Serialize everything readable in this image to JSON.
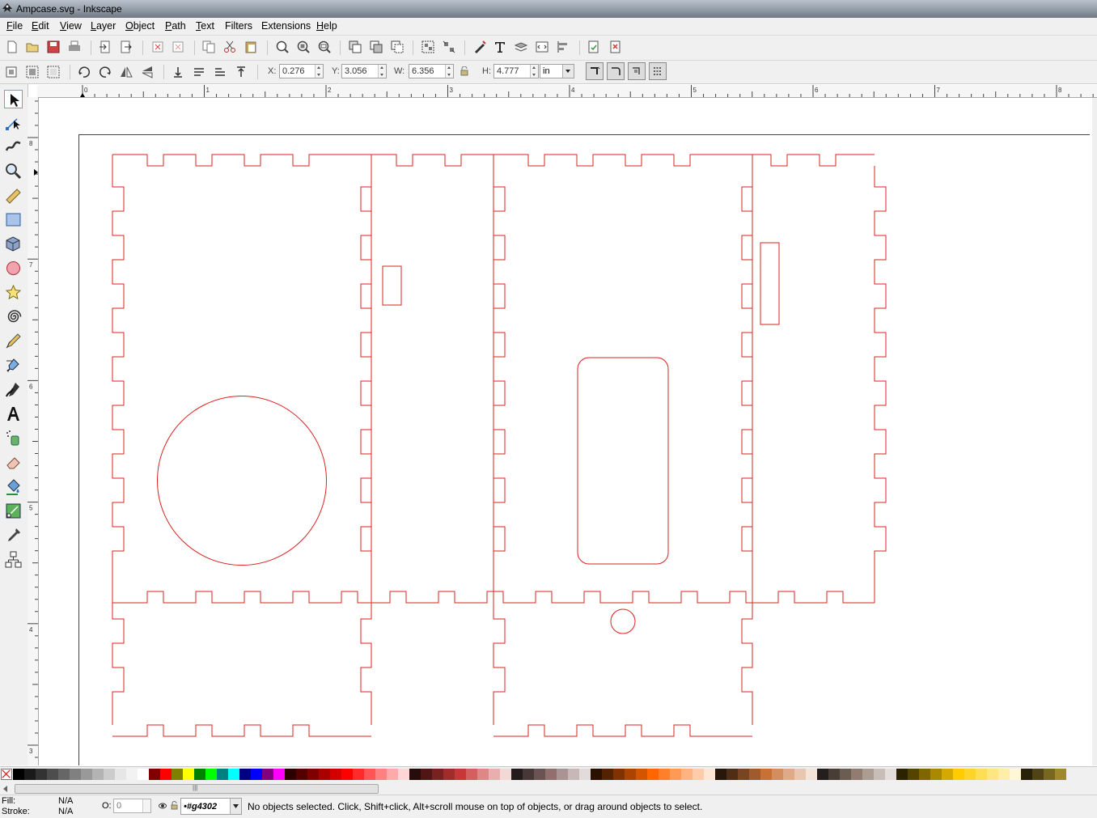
{
  "window": {
    "title": "Ampcase.svg - Inkscape"
  },
  "menus": [
    {
      "label": "File",
      "key": "F",
      "rest": "ile"
    },
    {
      "label": "Edit",
      "key": "E",
      "rest": "dit"
    },
    {
      "label": "View",
      "key": "V",
      "rest": "iew"
    },
    {
      "label": "Layer",
      "key": "L",
      "rest": "ayer"
    },
    {
      "label": "Object",
      "key": "O",
      "rest": "bject"
    },
    {
      "label": "Path",
      "key": "P",
      "rest": "ath"
    },
    {
      "label": "Text",
      "key": "T",
      "rest": "ext"
    },
    {
      "label": "Filters",
      "key": "",
      "rest": "Filters"
    },
    {
      "label": "Extensions",
      "key": "",
      "rest": "Extensions"
    },
    {
      "label": "Help",
      "key": "H",
      "rest": "elp"
    }
  ],
  "selector": {
    "x_label": "X:",
    "x_value": "0.276",
    "y_label": "Y:",
    "y_value": "3.056",
    "w_label": "W:",
    "w_value": "6.356",
    "h_label": "H:",
    "h_value": "4.777",
    "unit": "in"
  },
  "rulers": {
    "horizontal": [
      "0",
      "1",
      "2",
      "3",
      "4",
      "5",
      "6",
      "7",
      "8"
    ],
    "vertical": [
      "8",
      "7",
      "6",
      "5",
      "4",
      "3"
    ]
  },
  "palette": {
    "colors": [
      "#000000",
      "#1a1a1a",
      "#333333",
      "#4d4d4d",
      "#666666",
      "#808080",
      "#999999",
      "#b3b3b3",
      "#cccccc",
      "#e6e6e6",
      "#f2f2f2",
      "#ffffff",
      "#800000",
      "#ff0000",
      "#808000",
      "#ffff00",
      "#008000",
      "#00ff00",
      "#008080",
      "#00ffff",
      "#000080",
      "#0000ff",
      "#800080",
      "#ff00ff",
      "#2b0000",
      "#550000",
      "#800000",
      "#aa0000",
      "#d40000",
      "#ff0000",
      "#ff2a2a",
      "#ff5555",
      "#ff8080",
      "#ffaaaa",
      "#ffd5d5",
      "#280b0b",
      "#501616",
      "#782121",
      "#a02c2c",
      "#c83737",
      "#d35f5f",
      "#de8787",
      "#e9afaf",
      "#f4d7d7",
      "#241c1c",
      "#483737",
      "#6c5353",
      "#916f6f",
      "#ac9393",
      "#c8b7b7",
      "#e3dbdb",
      "#2b1100",
      "#552200",
      "#803300",
      "#aa4400",
      "#d45500",
      "#ff6600",
      "#ff7f2a",
      "#ff9955",
      "#ffb380",
      "#ffccaa",
      "#ffe6d5",
      "#28170b",
      "#502d16",
      "#784421",
      "#a05a2c",
      "#c87137",
      "#d38d5f",
      "#deaa87",
      "#e9c6af",
      "#f4e3d7",
      "#241f1c",
      "#483e37",
      "#6c5d53",
      "#917c6f",
      "#ac9d93",
      "#c8beb7",
      "#e3dedb",
      "#2b2200",
      "#554400",
      "#806600",
      "#aa8800",
      "#d4aa00",
      "#ffcc00",
      "#ffd42a",
      "#ffdd55",
      "#ffe680",
      "#ffeeaa",
      "#fff6d5",
      "#28220b",
      "#504416",
      "#786721",
      "#a0892c"
    ]
  },
  "status": {
    "fill_label": "Fill:",
    "fill_value": "N/A",
    "stroke_label": "Stroke:",
    "stroke_value": "N/A",
    "opacity_label": "O:",
    "opacity_value": "0",
    "layer": "•#g4302",
    "message": "No objects selected. Click, Shift+click, Alt+scroll mouse on top of objects, or drag around objects to select."
  },
  "colors": {
    "cut_line": "#dd2222",
    "page_border": "#333333"
  }
}
